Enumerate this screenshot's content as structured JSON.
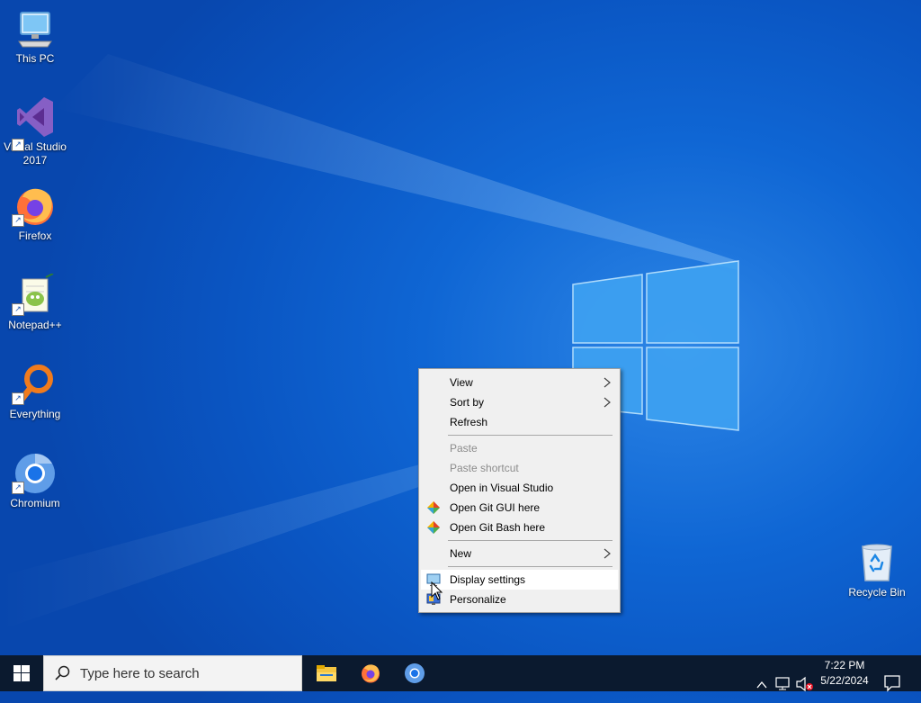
{
  "desktop": {
    "icons": [
      {
        "label": "This PC",
        "icon": "this-pc-icon"
      },
      {
        "label": "Visual Studio 2017",
        "icon": "visual-studio-icon"
      },
      {
        "label": "Firefox",
        "icon": "firefox-icon"
      },
      {
        "label": "Notepad++",
        "icon": "notepadpp-icon"
      },
      {
        "label": "Everything",
        "icon": "everything-icon"
      },
      {
        "label": "Chromium",
        "icon": "chromium-icon"
      },
      {
        "label": "Recycle Bin",
        "icon": "recycle-bin-icon"
      }
    ]
  },
  "context_menu": {
    "items": [
      {
        "label": "View",
        "submenu": true,
        "enabled": true
      },
      {
        "label": "Sort by",
        "submenu": true,
        "enabled": true
      },
      {
        "label": "Refresh",
        "enabled": true
      },
      {
        "label": "Paste",
        "enabled": false
      },
      {
        "label": "Paste shortcut",
        "enabled": false
      },
      {
        "label": "Open in Visual Studio",
        "enabled": true
      },
      {
        "label": "Open Git GUI here",
        "enabled": true,
        "icon": "git-icon"
      },
      {
        "label": "Open Git Bash here",
        "enabled": true,
        "icon": "git-icon"
      },
      {
        "label": "New",
        "submenu": true,
        "enabled": true
      },
      {
        "label": "Display settings",
        "enabled": true,
        "icon": "display-icon",
        "highlighted": true
      },
      {
        "label": "Personalize",
        "enabled": true,
        "icon": "personalize-icon"
      }
    ]
  },
  "taskbar": {
    "search_placeholder": "Type here to search",
    "pinned": [
      "file-explorer-icon",
      "firefox-icon",
      "chromium-icon"
    ],
    "clock": {
      "time": "7:22 PM",
      "date": "5/22/2024"
    },
    "tray_icons": [
      "chevron-up-icon",
      "network-icon",
      "volume-muted-icon",
      "notification-icon"
    ]
  },
  "colors": {
    "taskbar_bg": "#0b1a2f",
    "menu_bg": "#f0f0f0",
    "desktop_accent": "#0f66d4"
  }
}
